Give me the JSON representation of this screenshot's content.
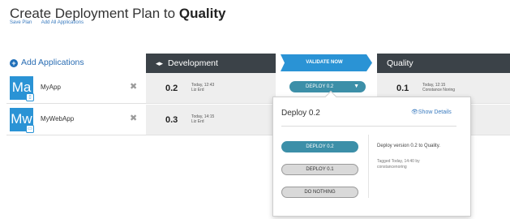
{
  "page": {
    "title_prefix": "Create Deployment Plan to ",
    "title_target": "Quality",
    "links": [
      "Save Plan",
      "Add All Applications"
    ]
  },
  "columns": {
    "add_applications": "Add Applications",
    "development": "Development",
    "validate_now": "VALIDATE NOW",
    "quality": "Quality"
  },
  "apps": [
    {
      "initials": "Ma",
      "name": "MyApp",
      "dev_version": "0.2",
      "dev_time": "Today, 12:43",
      "dev_user": "Liz Erd",
      "deploy_label": "DEPLOY 0.2",
      "qa_version": "0.1",
      "qa_time": "Today, 12:15",
      "qa_user": "Constance Noring"
    },
    {
      "initials": "Mw",
      "name": "MyWebApp",
      "dev_version": "0.3",
      "dev_time": "Today, 14:15",
      "dev_user": "Liz Erd"
    }
  ],
  "popover": {
    "title": "Deploy 0.2",
    "show_details": "Show Details",
    "options": [
      "DEPLOY 0.2",
      "DEPLOY 0.1",
      "DO NOTHING"
    ],
    "description": "Deploy version 0.2 to Quality.",
    "tagged_line1": "Tagged Today, 14:40 by",
    "tagged_line2": "constancenoring"
  },
  "colors": {
    "accent": "#2a93d5",
    "header_dark": "#3b4248",
    "deploy_teal": "#3c8fa8",
    "link_blue": "#3a7bbf"
  },
  "icons": {
    "remove": "close-icon",
    "add": "plus-circle-icon",
    "details": "eye-icon",
    "caret": "caret-down-icon"
  }
}
